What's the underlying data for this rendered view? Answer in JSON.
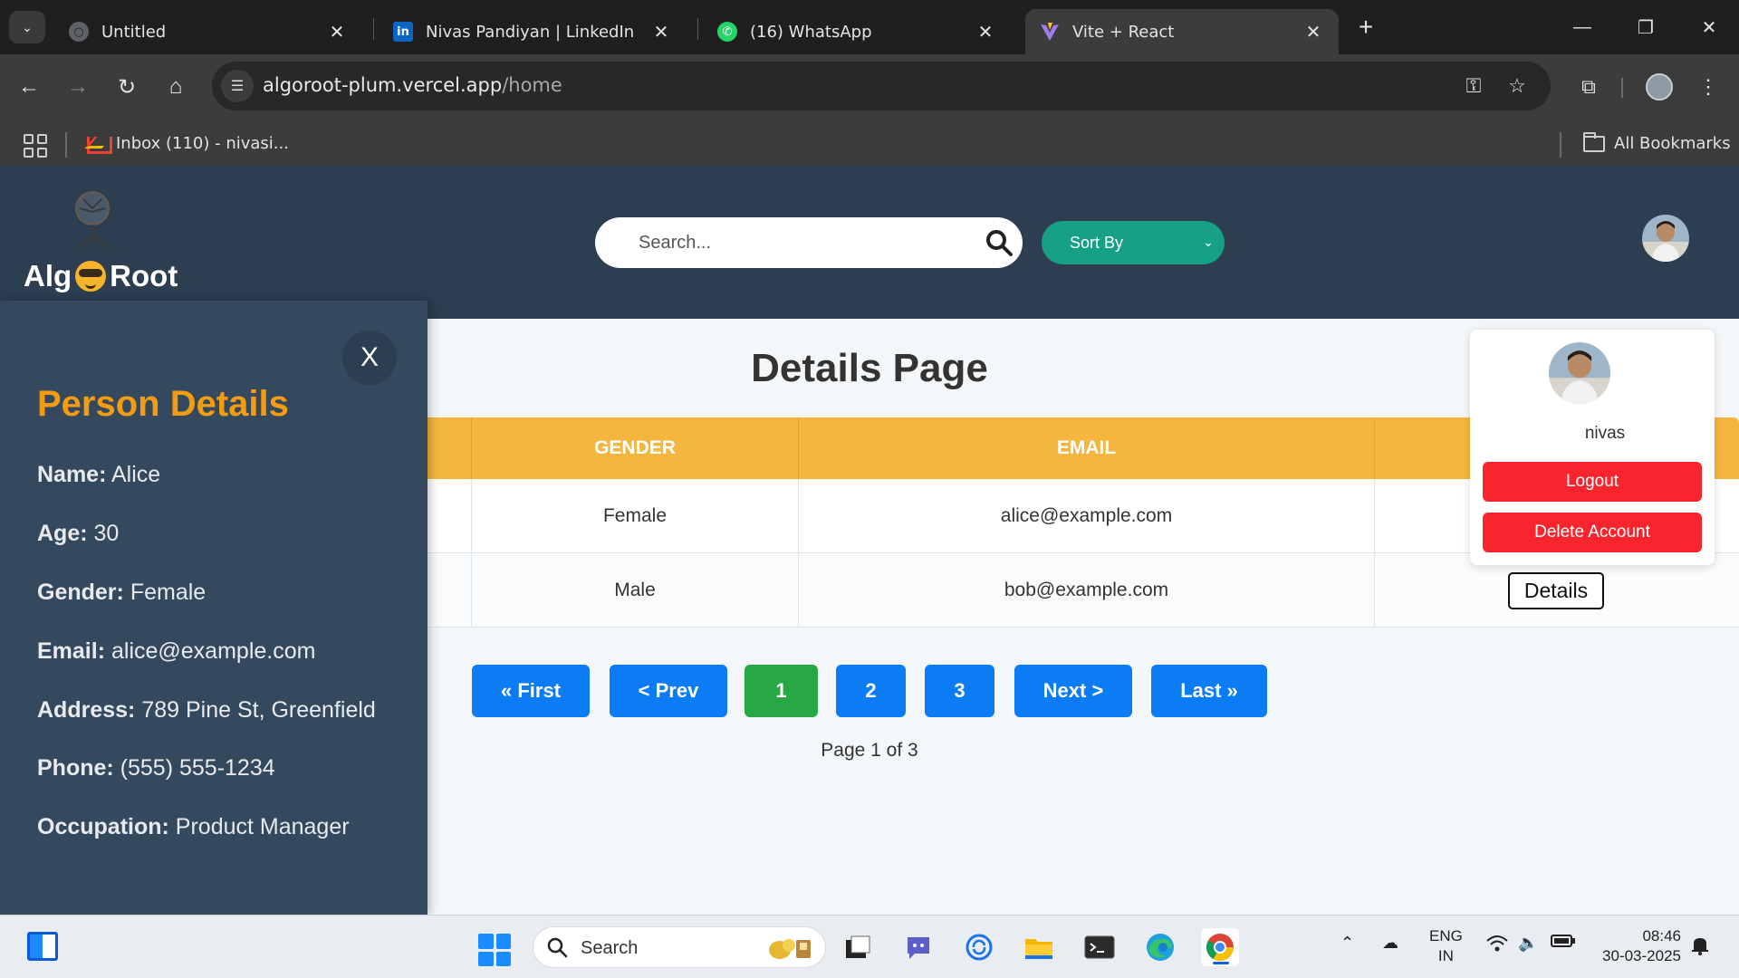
{
  "browser": {
    "tabs": [
      {
        "title": "Untitled",
        "favicon": "globe-icon"
      },
      {
        "title": "Nivas Pandiyan | LinkedIn",
        "favicon": "linkedin-icon"
      },
      {
        "title": "(16) WhatsApp",
        "favicon": "whatsapp-icon"
      },
      {
        "title": "Vite + React",
        "favicon": "vite-icon"
      }
    ],
    "active_tab_index": 3,
    "url": {
      "host": "algoroot-plum.vercel.app",
      "path": "/home"
    },
    "bookmarks": [
      {
        "label": "Inbox (110) - nivasi...",
        "icon": "gmail-icon"
      }
    ],
    "all_bookmarks_label": "All Bookmarks"
  },
  "app": {
    "logo_left": "Alg",
    "logo_right": "Root",
    "search": {
      "placeholder": "Search..."
    },
    "sort": {
      "label": "Sort By"
    }
  },
  "page": {
    "title": "Details Page",
    "table": {
      "columns": [
        "GENDER",
        "EMAIL"
      ],
      "rows": [
        {
          "gender": "Female",
          "email": "alice@example.com"
        },
        {
          "gender": "Male",
          "email": "bob@example.com",
          "action": "Details"
        }
      ]
    },
    "pagination": {
      "first": "« First",
      "prev": "< Prev",
      "pages": [
        "1",
        "2",
        "3"
      ],
      "current": "1",
      "next": "Next >",
      "last": "Last »",
      "info": "Page 1 of 3"
    }
  },
  "profile_menu": {
    "username": "nivas",
    "logout": "Logout",
    "delete": "Delete Account"
  },
  "person_panel": {
    "close": "X",
    "title": "Person Details",
    "fields": [
      {
        "label": "Name:",
        "value": "Alice"
      },
      {
        "label": "Age:",
        "value": "30"
      },
      {
        "label": "Gender:",
        "value": "Female"
      },
      {
        "label": "Email:",
        "value": "alice@example.com"
      },
      {
        "label": "Address:",
        "value": "789 Pine St, Greenfield"
      },
      {
        "label": "Phone:",
        "value": "(555) 555-1234"
      },
      {
        "label": "Occupation:",
        "value": "Product Manager"
      }
    ]
  },
  "taskbar": {
    "search_label": "Search",
    "lang_top": "ENG",
    "lang_bottom": "IN",
    "time": "08:46",
    "date": "30-03-2025"
  },
  "colors": {
    "header_bg": "#2c3e50",
    "table_header": "#f4b63f",
    "pager_blue": "#0b7cf3",
    "pager_current": "#28a745",
    "danger": "#f8252f",
    "panel_title": "#f39c12",
    "sort_button": "#16a085"
  }
}
